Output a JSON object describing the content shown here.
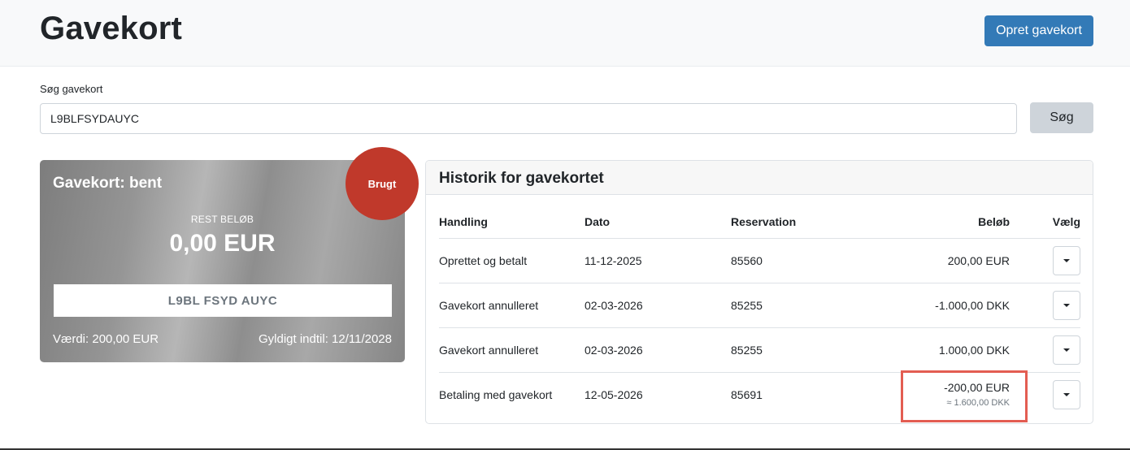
{
  "header": {
    "title": "Gavekort",
    "create_button": "Opret gavekort"
  },
  "search": {
    "label": "Søg gavekort",
    "value": "L9BLFSYDAUYC",
    "button": "Søg"
  },
  "gift_card": {
    "title": "Gavekort: bent",
    "rest_label": "REST BELØB",
    "rest_value": "0,00 EUR",
    "code": "L9BL FSYD AUYC",
    "value_text": "Værdi: 200,00 EUR",
    "valid_text": "Gyldigt indtil: 12/11/2028",
    "status_badge": "Brugt"
  },
  "history": {
    "title": "Historik for gavekortet",
    "columns": [
      "Handling",
      "Dato",
      "Reservation",
      "Beløb",
      "Vælg"
    ],
    "rows": [
      {
        "action": "Oprettet og betalt",
        "date": "11-12-2025",
        "reservation": "85560",
        "amount": "200,00 EUR",
        "amount_sub": ""
      },
      {
        "action": "Gavekort annulleret",
        "date": "02-03-2026",
        "reservation": "85255",
        "amount": "-1.000,00 DKK",
        "amount_sub": ""
      },
      {
        "action": "Gavekort annulleret",
        "date": "02-03-2026",
        "reservation": "85255",
        "amount": "1.000,00 DKK",
        "amount_sub": ""
      },
      {
        "action": "Betaling med gavekort",
        "date": "12-05-2026",
        "reservation": "85691",
        "amount": "-200,00 EUR",
        "amount_sub": "≈ 1.600,00 DKK"
      }
    ]
  },
  "colors": {
    "primary": "#337ab7",
    "badge": "#c0392b",
    "highlight": "#e35d52"
  },
  "icons": {
    "dropdown": "caret-down-icon"
  }
}
